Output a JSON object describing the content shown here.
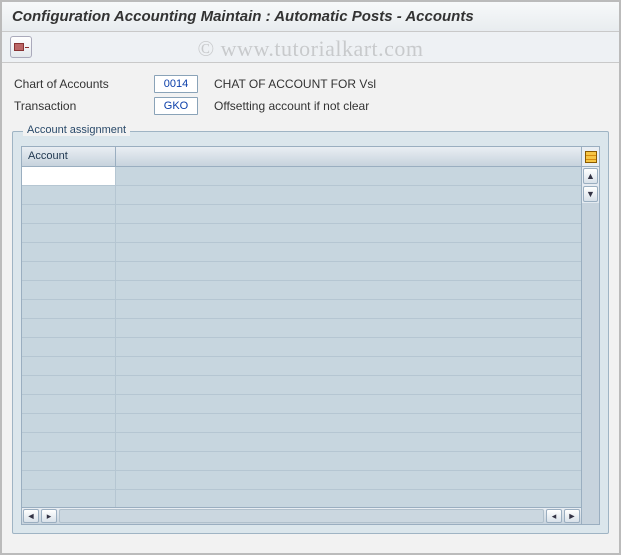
{
  "title": "Configuration Accounting Maintain : Automatic Posts - Accounts",
  "watermark": "© www.tutorialkart.com",
  "toolbar": {
    "posting_period_name": "posting-period-button"
  },
  "form": {
    "chart_label": "Chart of Accounts",
    "chart_value": "0014",
    "chart_desc": "CHAT OF ACCOUNT FOR Vsl",
    "transaction_label": "Transaction",
    "transaction_value": "GKO",
    "transaction_desc": "Offsetting account if not clear"
  },
  "panel": {
    "title": "Account assignment",
    "column_header": "Account",
    "rows": [
      "",
      "",
      "",
      "",
      "",
      "",
      "",
      "",
      "",
      "",
      "",
      "",
      "",
      "",
      "",
      "",
      "",
      ""
    ]
  }
}
